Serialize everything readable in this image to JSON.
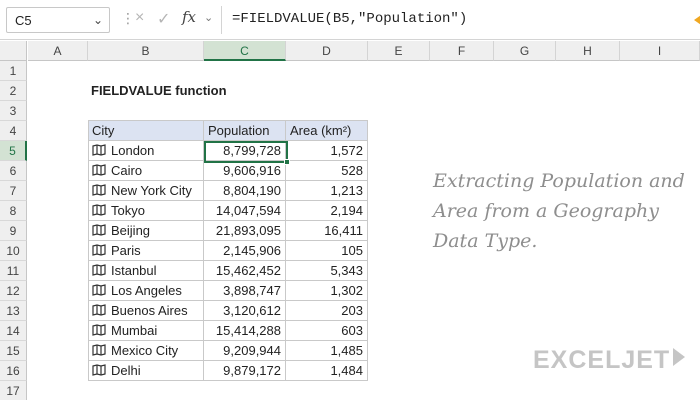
{
  "formula_bar": {
    "name_box": "C5",
    "cancel_icon": "×",
    "enter_icon": "✓",
    "fx_label": "fx",
    "formula": "=FIELDVALUE(B5,\"Population\")",
    "arrow_color": "#f0a822"
  },
  "columns": [
    "A",
    "B",
    "C",
    "D",
    "E",
    "F",
    "G",
    "H",
    "I"
  ],
  "selected_column": "C",
  "rows": [
    "1",
    "2",
    "3",
    "4",
    "5",
    "6",
    "7",
    "8",
    "9",
    "10",
    "11",
    "12",
    "13",
    "14",
    "15",
    "16",
    "17"
  ],
  "selected_row": "5",
  "sheet": {
    "title": "FIELDVALUE function",
    "headers": {
      "city": "City",
      "population": "Population",
      "area": "Area (km²)"
    },
    "city_icon": "map-icon",
    "table": [
      {
        "city": "London",
        "population": "8,799,728",
        "area": "1,572"
      },
      {
        "city": "Cairo",
        "population": "9,606,916",
        "area": "528"
      },
      {
        "city": "New York City",
        "population": "8,804,190",
        "area": "1,213"
      },
      {
        "city": "Tokyo",
        "population": "14,047,594",
        "area": "2,194"
      },
      {
        "city": "Beijing",
        "population": "21,893,095",
        "area": "16,411"
      },
      {
        "city": "Paris",
        "population": "2,145,906",
        "area": "105"
      },
      {
        "city": "Istanbul",
        "population": "15,462,452",
        "area": "5,343"
      },
      {
        "city": "Los Angeles",
        "population": "3,898,747",
        "area": "1,302"
      },
      {
        "city": "Buenos Aires",
        "population": "3,120,612",
        "area": "203"
      },
      {
        "city": "Mumbai",
        "population": "15,414,288",
        "area": "603"
      },
      {
        "city": "Mexico City",
        "population": "9,209,944",
        "area": "1,485"
      },
      {
        "city": "Delhi",
        "population": "9,879,172",
        "area": "1,484"
      }
    ],
    "note": "Extracting Population and Area from a Geography Data Type."
  },
  "brand": {
    "logo": "EXCELJET"
  },
  "colors": {
    "accent": "#217346",
    "header_fill": "#dce3f2",
    "note_text": "#8e8e8e"
  }
}
